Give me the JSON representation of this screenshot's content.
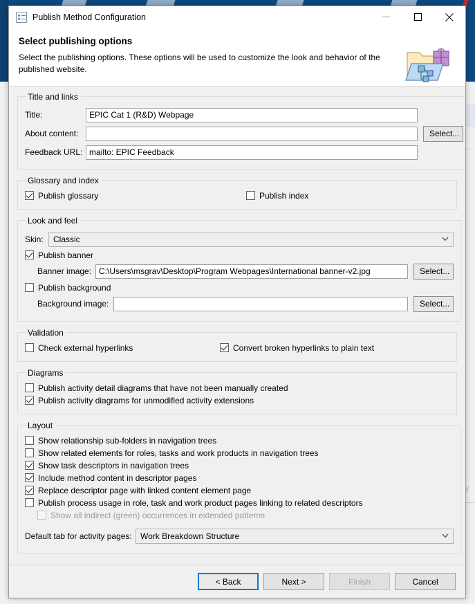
{
  "window": {
    "title": "Publish Method Configuration",
    "icon": "config-list-icon",
    "controls": {
      "minimize": "minimize-icon",
      "maximize": "maximize-icon",
      "close": "close-icon"
    }
  },
  "header": {
    "title": "Select publishing options",
    "description": "Select the publishing options. These options will be used to customize the look and behavior of the published website.",
    "art": "publish-folder-icon"
  },
  "groups": {
    "title_and_links": {
      "legend": "Title and links",
      "fields": [
        {
          "label": "Title:",
          "value": "EPIC Cat 1 (R&D) Webpage",
          "placeholder": "",
          "has_select": false
        },
        {
          "label": "About content:",
          "value": "",
          "placeholder": "",
          "has_select": true,
          "select_label": "Select..."
        },
        {
          "label": "Feedback URL:",
          "value": "mailto: EPIC Feedback",
          "placeholder": "",
          "has_select": false
        }
      ]
    },
    "glossary_and_index": {
      "legend": "Glossary and index",
      "checkboxes": [
        {
          "label": "Publish glossary",
          "checked": true,
          "disabled": false
        },
        {
          "label": "Publish index",
          "checked": false,
          "disabled": false
        }
      ]
    },
    "look_and_feel": {
      "legend": "Look and feel",
      "skin_label": "Skin:",
      "skin_value": "Classic",
      "publish_banner": {
        "label": "Publish banner",
        "checked": true,
        "disabled": false
      },
      "banner_image_label": "Banner image:",
      "banner_image_value": "C:\\Users\\msgrav\\Desktop\\Program Webpages\\International banner-v2.jpg",
      "banner_select_label": "Select...",
      "publish_background": {
        "label": "Publish background",
        "checked": false,
        "disabled": false
      },
      "background_image_label": "Background image:",
      "background_image_value": "",
      "background_select_label": "Select..."
    },
    "validation": {
      "legend": "Validation",
      "checkboxes": [
        {
          "label": "Check external hyperlinks",
          "checked": false,
          "disabled": false
        },
        {
          "label": "Convert broken hyperlinks to plain text",
          "checked": true,
          "disabled": false
        }
      ]
    },
    "diagrams": {
      "legend": "Diagrams",
      "checkboxes": [
        {
          "label": "Publish activity detail diagrams that have not been manually created",
          "checked": false,
          "disabled": false
        },
        {
          "label": "Publish activity diagrams for unmodified activity extensions",
          "checked": true,
          "disabled": false
        }
      ]
    },
    "layout": {
      "legend": "Layout",
      "checkboxes": [
        {
          "label": "Show relationship sub-folders in navigation trees",
          "checked": false,
          "disabled": false,
          "indent": false
        },
        {
          "label": "Show related elements for roles, tasks and work products in navigation trees",
          "checked": false,
          "disabled": false,
          "indent": false
        },
        {
          "label": "Show task descriptors in navigation trees",
          "checked": true,
          "disabled": false,
          "indent": false
        },
        {
          "label": "Include method content in descriptor pages",
          "checked": true,
          "disabled": false,
          "indent": false
        },
        {
          "label": "Replace descriptor page with linked content element page",
          "checked": true,
          "disabled": false,
          "indent": false
        },
        {
          "label": "Publish process usage in role, task and work product pages linking to related descriptors",
          "checked": false,
          "disabled": false,
          "indent": false
        },
        {
          "label": "Show all indirect (green) occurrences in extended patterns",
          "checked": false,
          "disabled": true,
          "indent": true
        }
      ],
      "default_tab_label": "Default tab for activity pages:",
      "default_tab_value": "Work Breakdown Structure"
    }
  },
  "footer": {
    "buttons": [
      {
        "label": "< Back",
        "state": "focused"
      },
      {
        "label": "Next >",
        "state": "normal"
      },
      {
        "label": "Finish",
        "state": "disabled"
      },
      {
        "label": "Cancel",
        "state": "normal"
      }
    ]
  },
  "background": {
    "faint_text": "ory",
    "accent_color": "#0d4a82",
    "focus_color": "#0078d7"
  }
}
